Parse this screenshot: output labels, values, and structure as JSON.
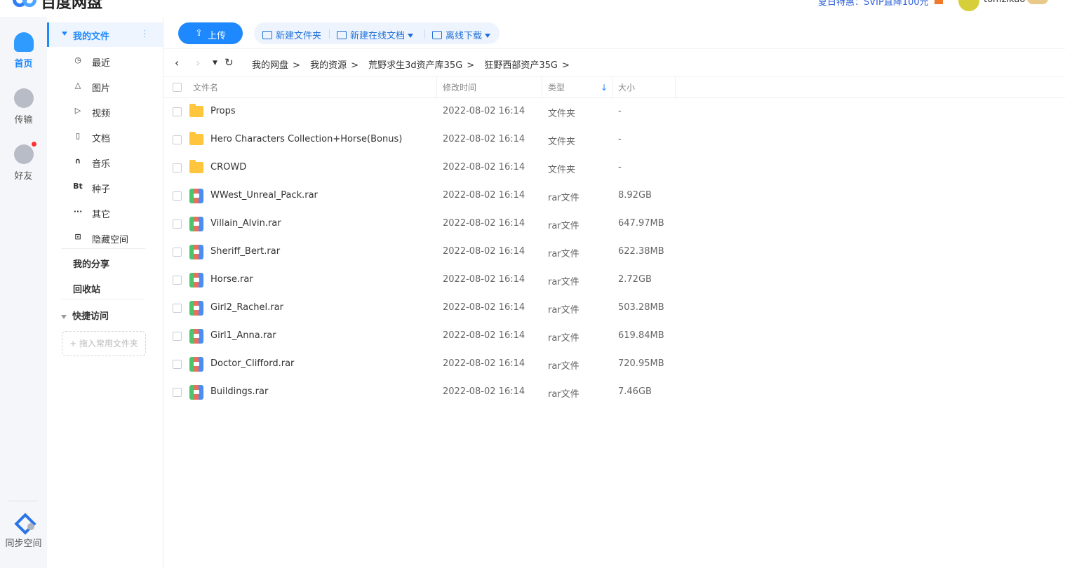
{
  "app": {
    "title": "百度网盘"
  },
  "header": {
    "promo": "夏日特惠：SVIP直降100元",
    "username": "tomzikao"
  },
  "rail": {
    "items": [
      {
        "label": "首页",
        "icon": "cloud-icon"
      },
      {
        "label": "传输",
        "icon": "transfer-icon"
      },
      {
        "label": "好友",
        "icon": "friends-icon"
      }
    ],
    "sync_label": "同步空间"
  },
  "sidebar": {
    "my_files": "我的文件",
    "items": [
      {
        "label": "最近",
        "icon": "clock-icon",
        "glyph": "◷"
      },
      {
        "label": "图片",
        "icon": "image-icon",
        "glyph": "△"
      },
      {
        "label": "视频",
        "icon": "video-icon",
        "glyph": "▷"
      },
      {
        "label": "文档",
        "icon": "document-icon",
        "glyph": "▯"
      },
      {
        "label": "音乐",
        "icon": "headphones-icon",
        "glyph": "∩"
      },
      {
        "label": "种子",
        "icon": "bt-icon",
        "glyph": "Bt"
      },
      {
        "label": "其它",
        "icon": "more-icon",
        "glyph": "···"
      },
      {
        "label": "隐藏空间",
        "icon": "lock-icon",
        "glyph": "⊡"
      }
    ],
    "my_share": "我的分享",
    "recycle": "回收站",
    "quick_access": "快捷访问",
    "drop_hint": "+ 拖入常用文件夹"
  },
  "toolbar": {
    "upload": "上传",
    "new_folder": "新建文件夹",
    "new_online_doc": "新建在线文档",
    "offline_download": "离线下载"
  },
  "breadcrumb": [
    "我的网盘",
    "我的资源",
    "荒野求生3d资产库35G",
    "狂野西部资产35G"
  ],
  "table": {
    "columns": {
      "name": "文件名",
      "modified": "修改时间",
      "type": "类型",
      "size": "大小"
    },
    "rows": [
      {
        "name": "Props",
        "modified": "2022-08-02 16:14",
        "type": "文件夹",
        "size": "-",
        "kind": "folder"
      },
      {
        "name": "Hero Characters Collection+Horse(Bonus)",
        "modified": "2022-08-02 16:14",
        "type": "文件夹",
        "size": "-",
        "kind": "folder"
      },
      {
        "name": "CROWD",
        "modified": "2022-08-02 16:14",
        "type": "文件夹",
        "size": "-",
        "kind": "folder"
      },
      {
        "name": "WWest_Unreal_Pack.rar",
        "modified": "2022-08-02 16:14",
        "type": "rar文件",
        "size": "8.92GB",
        "kind": "rar"
      },
      {
        "name": "Villain_Alvin.rar",
        "modified": "2022-08-02 16:14",
        "type": "rar文件",
        "size": "647.97MB",
        "kind": "rar"
      },
      {
        "name": "Sheriff_Bert.rar",
        "modified": "2022-08-02 16:14",
        "type": "rar文件",
        "size": "622.38MB",
        "kind": "rar"
      },
      {
        "name": "Horse.rar",
        "modified": "2022-08-02 16:14",
        "type": "rar文件",
        "size": "2.72GB",
        "kind": "rar"
      },
      {
        "name": "Girl2_Rachel.rar",
        "modified": "2022-08-02 16:14",
        "type": "rar文件",
        "size": "503.28MB",
        "kind": "rar"
      },
      {
        "name": "Girl1_Anna.rar",
        "modified": "2022-08-02 16:14",
        "type": "rar文件",
        "size": "619.84MB",
        "kind": "rar"
      },
      {
        "name": "Doctor_Clifford.rar",
        "modified": "2022-08-02 16:14",
        "type": "rar文件",
        "size": "720.95MB",
        "kind": "rar"
      },
      {
        "name": "Buildings.rar",
        "modified": "2022-08-02 16:14",
        "type": "rar文件",
        "size": "7.46GB",
        "kind": "rar"
      }
    ]
  },
  "colors": {
    "accent": "#1e88ff",
    "folder": "#ffc53d",
    "badge": "#ff3333"
  }
}
